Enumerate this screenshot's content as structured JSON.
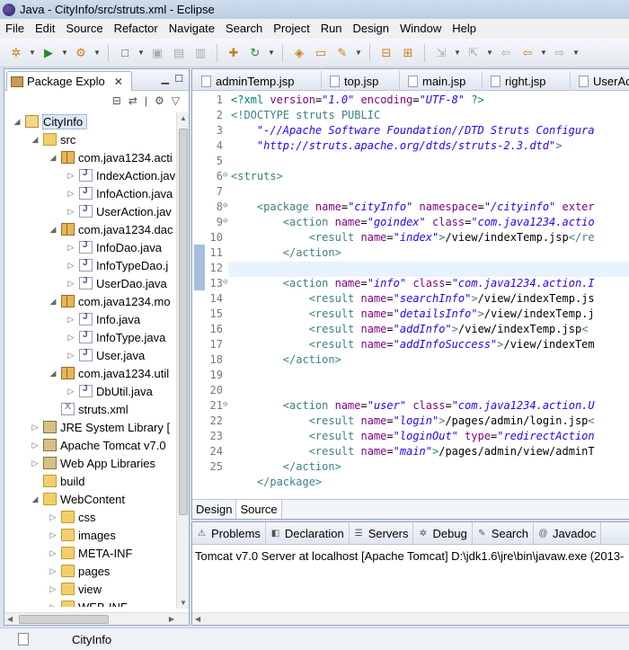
{
  "window": {
    "title": "Java - CityInfo/src/struts.xml - Eclipse"
  },
  "menubar": [
    "File",
    "Edit",
    "Source",
    "Refactor",
    "Navigate",
    "Search",
    "Project",
    "Run",
    "Design",
    "Window",
    "Help"
  ],
  "package_explorer": {
    "tab_label": "Package Explo",
    "tree": [
      {
        "label": "CityInfo",
        "depth": 0,
        "icon": "project",
        "expanded": true,
        "selected": true
      },
      {
        "label": "src",
        "depth": 1,
        "icon": "src-folder",
        "expanded": true
      },
      {
        "label": "com.java1234.acti",
        "depth": 2,
        "icon": "package",
        "expanded": true
      },
      {
        "label": "IndexAction.jav",
        "depth": 3,
        "icon": "java-file",
        "expanded": false
      },
      {
        "label": "InfoAction.java",
        "depth": 3,
        "icon": "java-file",
        "expanded": false
      },
      {
        "label": "UserAction.jav",
        "depth": 3,
        "icon": "java-file",
        "expanded": false
      },
      {
        "label": "com.java1234.dac",
        "depth": 2,
        "icon": "package",
        "expanded": true
      },
      {
        "label": "InfoDao.java",
        "depth": 3,
        "icon": "java-file",
        "expanded": false
      },
      {
        "label": "InfoTypeDao.j",
        "depth": 3,
        "icon": "java-file",
        "expanded": false
      },
      {
        "label": "UserDao.java",
        "depth": 3,
        "icon": "java-file",
        "expanded": false
      },
      {
        "label": "com.java1234.mo",
        "depth": 2,
        "icon": "package",
        "expanded": true
      },
      {
        "label": "Info.java",
        "depth": 3,
        "icon": "java-file",
        "expanded": false
      },
      {
        "label": "InfoType.java",
        "depth": 3,
        "icon": "java-file",
        "expanded": false
      },
      {
        "label": "User.java",
        "depth": 3,
        "icon": "java-file",
        "expanded": false
      },
      {
        "label": "com.java1234.util",
        "depth": 2,
        "icon": "package",
        "expanded": true
      },
      {
        "label": "DbUtil.java",
        "depth": 3,
        "icon": "java-file",
        "expanded": false
      },
      {
        "label": "struts.xml",
        "depth": 2,
        "icon": "xml-file",
        "expanded": null
      },
      {
        "label": "JRE System Library [",
        "depth": 1,
        "icon": "library",
        "expanded": false
      },
      {
        "label": "Apache Tomcat v7.0",
        "depth": 1,
        "icon": "library",
        "expanded": false
      },
      {
        "label": "Web App Libraries",
        "depth": 1,
        "icon": "library",
        "expanded": false
      },
      {
        "label": "build",
        "depth": 1,
        "icon": "folder",
        "expanded": null
      },
      {
        "label": "WebContent",
        "depth": 1,
        "icon": "folder",
        "expanded": true
      },
      {
        "label": "css",
        "depth": 2,
        "icon": "folder",
        "expanded": false
      },
      {
        "label": "images",
        "depth": 2,
        "icon": "folder",
        "expanded": false
      },
      {
        "label": "META-INF",
        "depth": 2,
        "icon": "folder",
        "expanded": false
      },
      {
        "label": "pages",
        "depth": 2,
        "icon": "folder",
        "expanded": false
      },
      {
        "label": "view",
        "depth": 2,
        "icon": "folder",
        "expanded": false
      },
      {
        "label": "WEB-INF",
        "depth": 2,
        "icon": "folder",
        "expanded": false
      }
    ]
  },
  "editor": {
    "tabs": [
      "adminTemp.jsp",
      "top.jsp",
      "main.jsp",
      "right.jsp",
      "UserAc"
    ],
    "lines": [
      {
        "n": "1",
        "fold": "",
        "segs": [
          [
            "pi",
            "<?xml "
          ],
          [
            "att",
            "version"
          ],
          [
            "",
            "="
          ],
          [
            "val",
            "\"1.0\""
          ],
          [
            "att",
            " encoding"
          ],
          [
            "",
            "="
          ],
          [
            "val",
            "\"UTF-8\""
          ],
          [
            "pi",
            " ?>"
          ]
        ]
      },
      {
        "n": "2",
        "fold": "",
        "segs": [
          [
            "dt",
            "<!DOCTYPE struts PUBLIC"
          ]
        ]
      },
      {
        "n": "3",
        "fold": "",
        "segs": [
          [
            "val",
            "    \"-//Apache Software Foundation//DTD Struts Configura"
          ]
        ]
      },
      {
        "n": "4",
        "fold": "",
        "segs": [
          [
            "val",
            "    \"http://struts.apache.org/dtds/struts-2.3.dtd\""
          ],
          [
            "dt",
            ">"
          ]
        ]
      },
      {
        "n": "5",
        "fold": "",
        "segs": [
          [
            "",
            ""
          ]
        ]
      },
      {
        "n": "6",
        "fold": "⊖",
        "segs": [
          [
            "tag",
            "<struts>"
          ]
        ]
      },
      {
        "n": "7",
        "fold": "",
        "segs": [
          [
            "",
            ""
          ]
        ]
      },
      {
        "n": "8",
        "fold": "⊖",
        "segs": [
          [
            "tag",
            "    <package "
          ],
          [
            "att",
            "name"
          ],
          [
            "",
            "="
          ],
          [
            "val",
            "\"cityInfo\""
          ],
          [
            "att",
            " namespace"
          ],
          [
            "",
            "="
          ],
          [
            "val",
            "\"/cityinfo\""
          ],
          [
            "att",
            " exter"
          ]
        ]
      },
      {
        "n": "9",
        "fold": "⊖",
        "segs": [
          [
            "tag",
            "        <action "
          ],
          [
            "att",
            "name"
          ],
          [
            "",
            "="
          ],
          [
            "val",
            "\"goindex\""
          ],
          [
            "att",
            " class"
          ],
          [
            "",
            "="
          ],
          [
            "val",
            "\"com.java1234.actio"
          ]
        ]
      },
      {
        "n": "10",
        "fold": "",
        "segs": [
          [
            "tag",
            "            <result "
          ],
          [
            "att",
            "name"
          ],
          [
            "",
            "="
          ],
          [
            "val",
            "\"index\""
          ],
          [
            "tag",
            ">"
          ],
          [
            "",
            "/view/indexTemp.jsp"
          ],
          [
            "tag",
            "</re"
          ]
        ]
      },
      {
        "n": "11",
        "fold": "",
        "segs": [
          [
            "tag",
            "        </action>"
          ]
        ]
      },
      {
        "n": "12",
        "fold": "",
        "segs": [
          [
            "",
            ""
          ]
        ]
      },
      {
        "n": "13",
        "fold": "⊖",
        "segs": [
          [
            "tag",
            "        <action "
          ],
          [
            "att",
            "name"
          ],
          [
            "",
            "="
          ],
          [
            "val",
            "\"info\""
          ],
          [
            "att",
            " class"
          ],
          [
            "",
            "="
          ],
          [
            "val",
            "\"com.java1234.action.I"
          ]
        ]
      },
      {
        "n": "14",
        "fold": "",
        "segs": [
          [
            "tag",
            "            <result "
          ],
          [
            "att",
            "name"
          ],
          [
            "",
            "="
          ],
          [
            "val",
            "\"searchInfo\""
          ],
          [
            "tag",
            ">"
          ],
          [
            "",
            "/view/indexTemp.js"
          ]
        ]
      },
      {
        "n": "15",
        "fold": "",
        "segs": [
          [
            "tag",
            "            <result "
          ],
          [
            "att",
            "name"
          ],
          [
            "",
            "="
          ],
          [
            "val",
            "\"detailsInfo\""
          ],
          [
            "tag",
            ">"
          ],
          [
            "",
            "/view/indexTemp.j"
          ]
        ]
      },
      {
        "n": "16",
        "fold": "",
        "segs": [
          [
            "tag",
            "            <result "
          ],
          [
            "att",
            "name"
          ],
          [
            "",
            "="
          ],
          [
            "val",
            "\"addInfo\""
          ],
          [
            "tag",
            ">"
          ],
          [
            "",
            "/view/indexTemp.jsp"
          ],
          [
            "tag",
            "<"
          ]
        ]
      },
      {
        "n": "17",
        "fold": "",
        "segs": [
          [
            "tag",
            "            <result "
          ],
          [
            "att",
            "name"
          ],
          [
            "",
            "="
          ],
          [
            "val",
            "\"addInfoSuccess\""
          ],
          [
            "tag",
            ">"
          ],
          [
            "",
            "/view/indexTem"
          ]
        ]
      },
      {
        "n": "18",
        "fold": "",
        "segs": [
          [
            "tag",
            "        </action>"
          ]
        ]
      },
      {
        "n": "19",
        "fold": "",
        "segs": [
          [
            "",
            ""
          ]
        ]
      },
      {
        "n": "20",
        "fold": "",
        "segs": [
          [
            "",
            ""
          ]
        ]
      },
      {
        "n": "21",
        "fold": "⊖",
        "segs": [
          [
            "tag",
            "        <action "
          ],
          [
            "att",
            "name"
          ],
          [
            "",
            "="
          ],
          [
            "val",
            "\"user\""
          ],
          [
            "att",
            " class"
          ],
          [
            "",
            "="
          ],
          [
            "val",
            "\"com.java1234.action.U"
          ]
        ]
      },
      {
        "n": "22",
        "fold": "",
        "segs": [
          [
            "tag",
            "            <result "
          ],
          [
            "att",
            "name"
          ],
          [
            "",
            "="
          ],
          [
            "val",
            "\"login\""
          ],
          [
            "tag",
            ">"
          ],
          [
            "",
            "/pages/admin/login.jsp"
          ],
          [
            "tag",
            "<"
          ]
        ]
      },
      {
        "n": "23",
        "fold": "",
        "segs": [
          [
            "tag",
            "            <result "
          ],
          [
            "att",
            "name"
          ],
          [
            "",
            "="
          ],
          [
            "val",
            "\"loginOut\""
          ],
          [
            "att",
            " type"
          ],
          [
            "",
            "="
          ],
          [
            "val",
            "\"redirectAction"
          ]
        ]
      },
      {
        "n": "24",
        "fold": "",
        "segs": [
          [
            "tag",
            "            <result "
          ],
          [
            "att",
            "name"
          ],
          [
            "",
            "="
          ],
          [
            "val",
            "\"main\""
          ],
          [
            "tag",
            ">"
          ],
          [
            "",
            "/pages/admin/view/adminT"
          ]
        ]
      },
      {
        "n": "25",
        "fold": "",
        "segs": [
          [
            "tag",
            "        </action>"
          ]
        ]
      },
      {
        "n": "",
        "fold": "",
        "segs": [
          [
            "tag",
            "    </package>"
          ]
        ]
      }
    ],
    "bottom_tabs": [
      "Design",
      "Source"
    ],
    "active_bottom_tab": "Source"
  },
  "console": {
    "tabs": [
      {
        "label": "Problems",
        "icon": "problems-icon"
      },
      {
        "label": "Declaration",
        "icon": "declaration-icon"
      },
      {
        "label": "Servers",
        "icon": "servers-icon"
      },
      {
        "label": "Debug",
        "icon": "debug-icon"
      },
      {
        "label": "Search",
        "icon": "search-icon"
      },
      {
        "label": "Javadoc",
        "icon": "javadoc-icon"
      }
    ],
    "text": "Tomcat v7.0 Server at localhost [Apache Tomcat] D:\\jdk1.6\\jre\\bin\\javaw.exe (2013-"
  },
  "statusbar": {
    "text": "CityInfo"
  }
}
